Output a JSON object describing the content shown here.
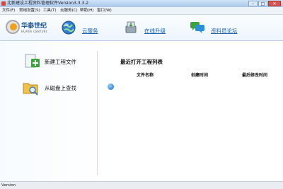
{
  "window": {
    "title": "北新建设工程资料管理软件Version3.3.3.2",
    "buttons": {
      "minimize": "–",
      "maximize": "□",
      "close": "✕"
    }
  },
  "menu": [
    "文件(F)",
    "常用设置(S)",
    "工具(T)",
    "云服务(C)",
    "帮助(H)",
    "窗口(W)"
  ],
  "header": {
    "logo": {
      "name_cn": "华泰世纪",
      "name_en": "HUATAI CENTURY"
    },
    "links": [
      {
        "label": "云服务",
        "icon": "globe-icon"
      },
      {
        "label": "在线升级",
        "icon": "update-icon"
      },
      {
        "label": "资料员论坛",
        "icon": "chat-bubbles-icon"
      }
    ]
  },
  "actions": [
    {
      "label": "新建工程文件",
      "icon": "add-document-icon"
    },
    {
      "label": "从磁盘上查找",
      "icon": "folder-search-icon"
    }
  ],
  "recent": {
    "title": "最近打开工程列表",
    "columns": [
      "文件名称",
      "创建时间",
      "最后修改时间"
    ]
  },
  "status": {
    "text": "Version"
  },
  "colors": {
    "link": "#1c62ad",
    "title_bar": "#a9c7e9",
    "accent_green": "#3aa63a"
  }
}
